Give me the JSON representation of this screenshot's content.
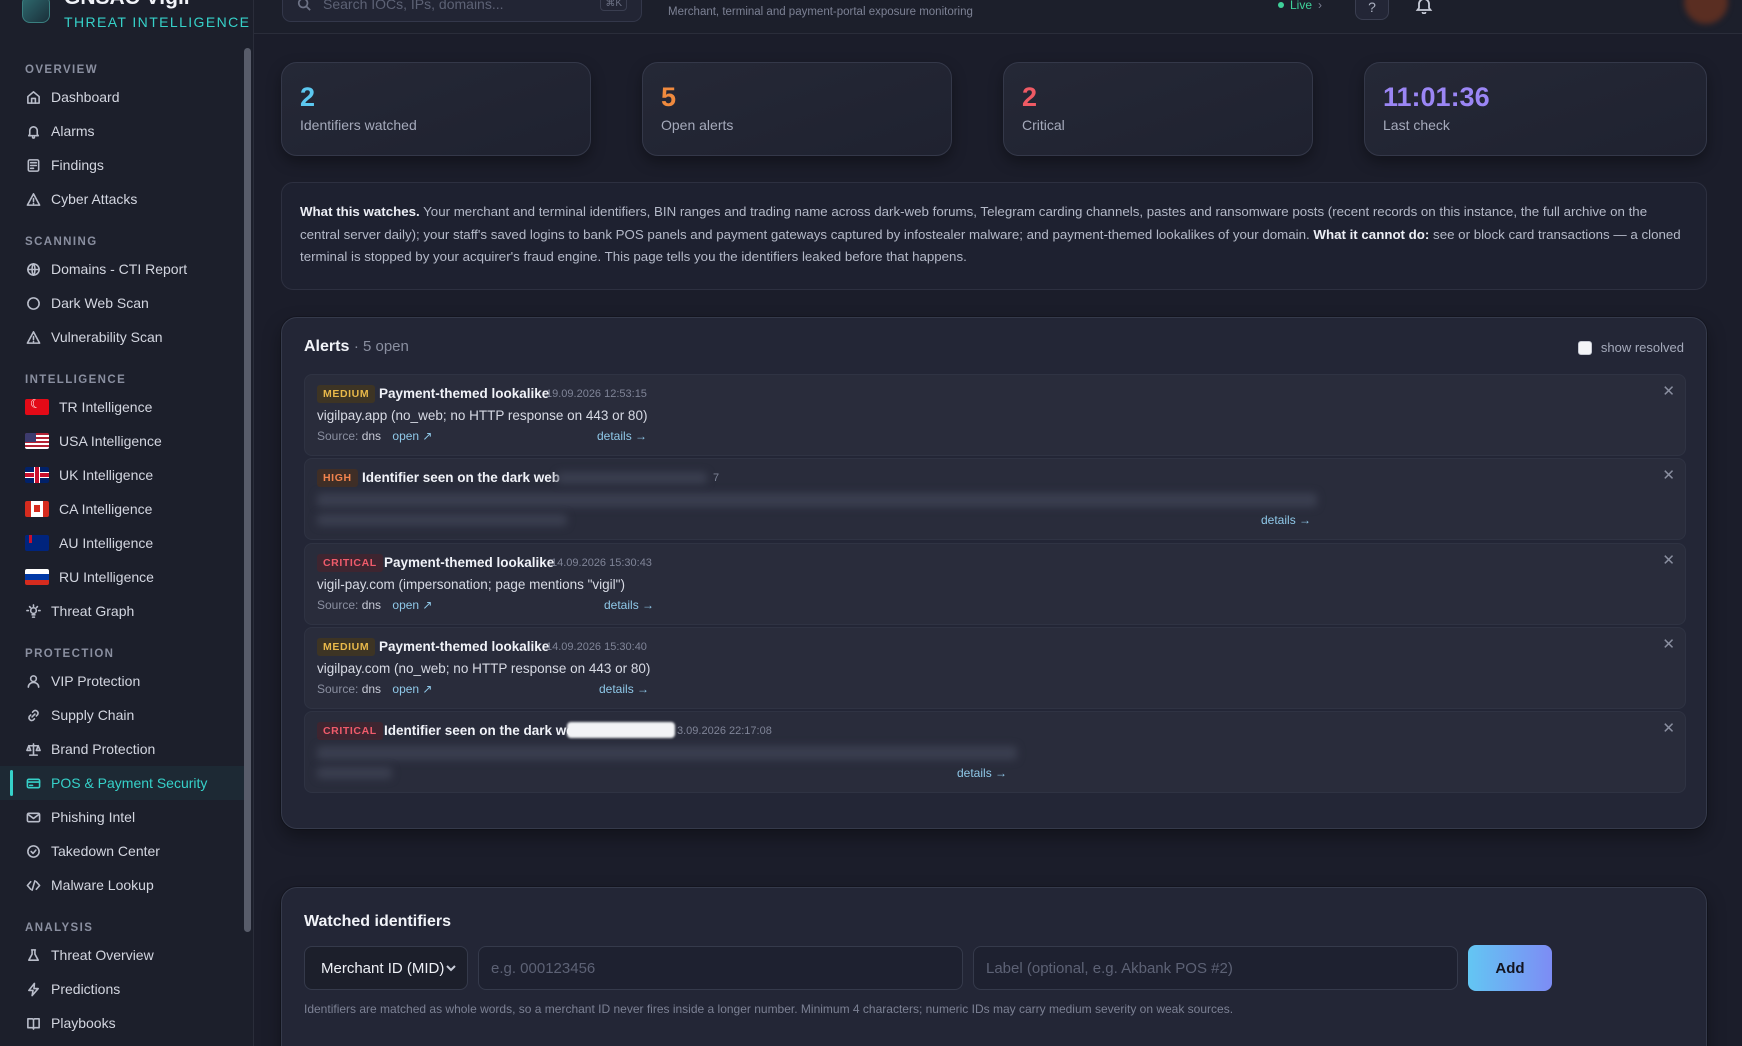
{
  "brand": {
    "name": "GNSAC Vigil",
    "subtitle": "THREAT INTELLIGENCE"
  },
  "sidebar": {
    "sections": [
      {
        "title": "OVERVIEW",
        "items": [
          {
            "label": "Dashboard",
            "icon": "home-icon"
          },
          {
            "label": "Alarms",
            "icon": "bell-icon"
          },
          {
            "label": "Findings",
            "icon": "document-icon"
          },
          {
            "label": "Cyber Attacks",
            "icon": "warning-icon"
          }
        ]
      },
      {
        "title": "SCANNING",
        "items": [
          {
            "label": "Domains - CTI Report",
            "icon": "globe-icon"
          },
          {
            "label": "Dark Web Scan",
            "icon": "circle-icon"
          },
          {
            "label": "Vulnerability Scan",
            "icon": "warning-icon"
          }
        ]
      },
      {
        "title": "INTELLIGENCE",
        "items": [
          {
            "label": "TR Intelligence",
            "icon": "flag-tr-icon"
          },
          {
            "label": "USA Intelligence",
            "icon": "flag-us-icon"
          },
          {
            "label": "UK Intelligence",
            "icon": "flag-uk-icon"
          },
          {
            "label": "CA Intelligence",
            "icon": "flag-ca-icon"
          },
          {
            "label": "AU Intelligence",
            "icon": "flag-au-icon"
          },
          {
            "label": "RU Intelligence",
            "icon": "flag-ru-icon"
          },
          {
            "label": "Threat Graph",
            "icon": "lightbulb-icon"
          }
        ]
      },
      {
        "title": "PROTECTION",
        "items": [
          {
            "label": "VIP Protection",
            "icon": "user-icon"
          },
          {
            "label": "Supply Chain",
            "icon": "link-icon"
          },
          {
            "label": "Brand Protection",
            "icon": "scale-icon"
          },
          {
            "label": "POS & Payment Security",
            "icon": "card-icon",
            "active": true
          },
          {
            "label": "Phishing Intel",
            "icon": "mail-icon"
          },
          {
            "label": "Takedown Center",
            "icon": "check-circle-icon"
          },
          {
            "label": "Malware Lookup",
            "icon": "code-icon"
          }
        ]
      },
      {
        "title": "ANALYSIS",
        "items": [
          {
            "label": "Threat Overview",
            "icon": "flask-icon"
          },
          {
            "label": "Predictions",
            "icon": "bolt-icon"
          },
          {
            "label": "Playbooks",
            "icon": "book-icon"
          }
        ]
      }
    ]
  },
  "topbar": {
    "search_placeholder": "Search IOCs, IPs, domains...",
    "search_shortcut": "⌘K",
    "page_subtitle": "Merchant, terminal and payment-portal exposure monitoring",
    "live_label": "Live",
    "help_label": "?"
  },
  "stats": [
    {
      "value": "2",
      "label": "Identifiers watched",
      "color": "#5cc8f0"
    },
    {
      "value": "5",
      "label": "Open alerts",
      "color": "#f08a3e"
    },
    {
      "value": "2",
      "label": "Critical",
      "color": "#ef5a64"
    },
    {
      "value": "11:01:36",
      "label": "Last check",
      "color": "#9b86f5"
    }
  ],
  "info": {
    "lead": "What this watches.",
    "body": " Your merchant and terminal identifiers, BIN ranges and trading name across dark-web forums, Telegram carding channels, pastes and ransomware posts (recent records on this instance, the full archive on the central server daily); your staff's saved logins to bank POS panels and payment gateways captured by infostealer malware; and payment-themed lookalikes of your domain.",
    "cannot_lead": " What it cannot do:",
    "cannot_body": " see or block card transactions — a cloned terminal is stopped by your acquirer's fraud engine. This page tells you the identifiers leaked before that happens."
  },
  "alerts": {
    "title": "Alerts",
    "count": "· 5 open",
    "show_resolved": "show resolved",
    "source_label": "Source:",
    "open_label": "open ↗",
    "details_label": "details →",
    "items": [
      {
        "severity": "MEDIUM",
        "title": "Payment-themed lookalike",
        "time": "19.09.2026 12:53:15",
        "desc": "vigilpay.app (no_web; no HTTP response on 443 or 80)",
        "source": "dns"
      },
      {
        "severity": "HIGH",
        "title": "Identifier seen on the dark web",
        "time": "7"
      },
      {
        "severity": "CRITICAL",
        "title": "Payment-themed lookalike",
        "time": "14.09.2026 15:30:43",
        "desc": "vigil-pay.com (impersonation; page mentions \"vigil\")",
        "source": "dns"
      },
      {
        "severity": "MEDIUM",
        "title": "Payment-themed lookalike",
        "time": "14.09.2026 15:30:40",
        "desc": "vigilpay.com (no_web; no HTTP response on 443 or 80)",
        "source": "dns"
      },
      {
        "severity": "CRITICAL",
        "title": "Identifier seen on the dark wel",
        "time": "3.09.2026 22:17:08"
      }
    ]
  },
  "watched": {
    "title": "Watched identifiers",
    "type_select": "Merchant ID (MID)",
    "id_placeholder": "e.g. 000123456",
    "label_placeholder": "Label (optional, e.g. Akbank POS #2)",
    "add_label": "Add",
    "note": "Identifiers are matched as whole words, so a merchant ID never fires inside a longer number. Minimum 4 characters; numeric IDs may carry medium severity on weak sources."
  }
}
